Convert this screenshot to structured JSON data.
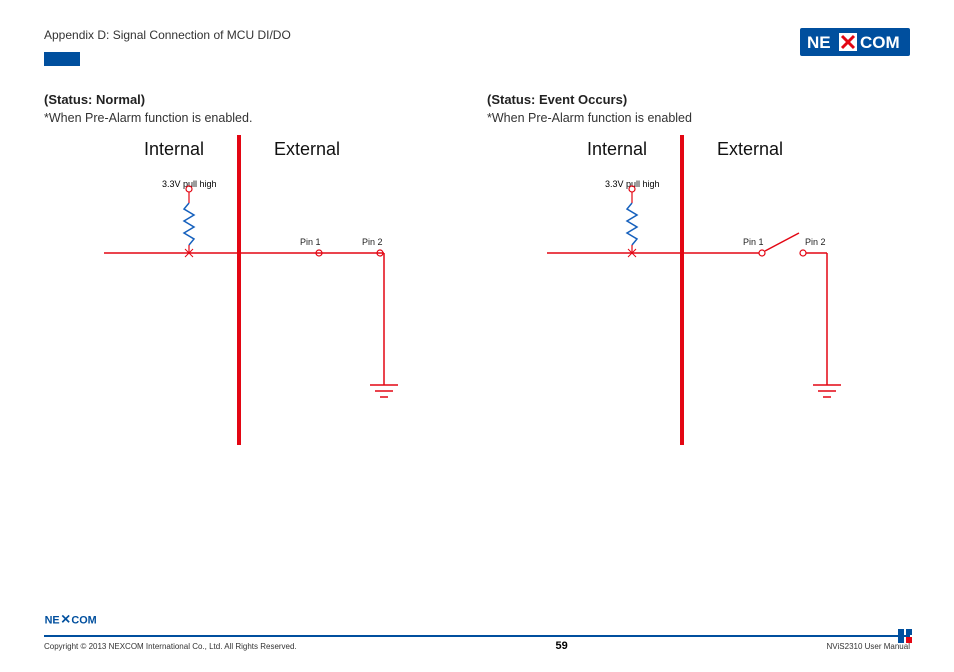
{
  "header": {
    "appendix_title": "Appendix D: Signal Connection of MCU DI/DO",
    "logo_text": "NEXCOM"
  },
  "columns": {
    "left": {
      "status": "(Status: Normal)",
      "note": "*When Pre-Alarm function is enabled.",
      "internal_label": "Internal",
      "external_label": "External",
      "pull_high": "3.3V pull high",
      "pin1": "Pin 1",
      "pin2": "Pin 2",
      "switch_open": false
    },
    "right": {
      "status": "(Status: Event Occurs)",
      "note": "*When Pre-Alarm function is enabled",
      "internal_label": "Internal",
      "external_label": "External",
      "pull_high": "3.3V pull high",
      "pin1": "Pin 1",
      "pin2": "Pin 2",
      "switch_open": true
    }
  },
  "footer": {
    "copyright": "Copyright © 2013 NEXCOM International Co., Ltd. All Rights Reserved.",
    "page": "59",
    "manual": "NViS2310 User Manual"
  },
  "colors": {
    "brand_blue": "#004f9e",
    "wire_red": "#e30613",
    "wire_blue": "#1560bd"
  }
}
